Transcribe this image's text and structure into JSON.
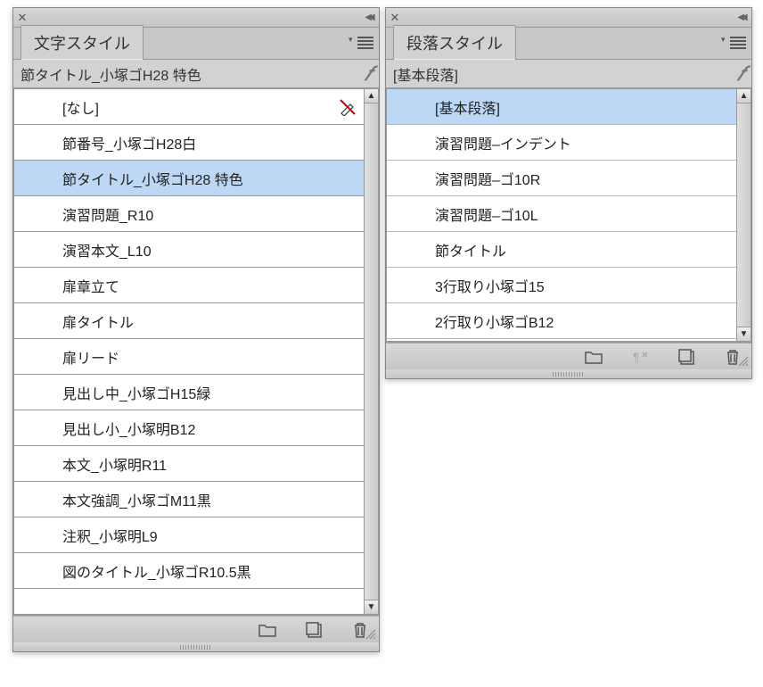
{
  "charPanel": {
    "tabLabel": "文字スタイル",
    "currentStyle": "節タイトル_小塚ゴH28 特色",
    "items": [
      "[なし]",
      "節番号_小塚ゴH28白",
      "節タイトル_小塚ゴH28 特色",
      "演習問題_R10",
      "演習本文_L10",
      "扉章立て",
      "扉タイトル",
      "扉リード",
      "見出し中_小塚ゴH15緑",
      "見出し小_小塚明B12",
      "本文_小塚明R11",
      "本文強調_小塚ゴM11黒",
      "注釈_小塚明L9",
      "図のタイトル_小塚ゴR10.5黒"
    ],
    "selectedIndex": 2,
    "noneIndex": 0
  },
  "paraPanel": {
    "tabLabel": "段落スタイル",
    "currentStyle": "[基本段落]",
    "items": [
      "[基本段落]",
      "演習問題‒インデント",
      "演習問題‒ゴ10R",
      "演習問題‒ゴ10L",
      "節タイトル",
      "3行取り小塚ゴ15",
      "2行取り小塚ゴB12"
    ],
    "selectedIndex": 0
  }
}
